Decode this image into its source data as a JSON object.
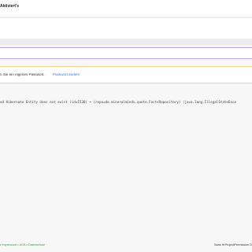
{
  "header": {
    "title": "Aktiviert's"
  },
  "notice": {
    "message": "n Sie ein eigenes Passwort.",
    "link_label": "Passwort ändern"
  },
  "error": {
    "text": "ed Hibernate Entity does not exist (id=1530) + (repo=de.mineralminds.quote.FactsRepository) (java.lang.IllegalStateExce"
  },
  "footer": {
    "links": [
      "",
      "Impressum",
      "AGB",
      "Datenschutz"
    ],
    "separator": "•",
    "right_text": "Saas HrProjectPermission D"
  }
}
